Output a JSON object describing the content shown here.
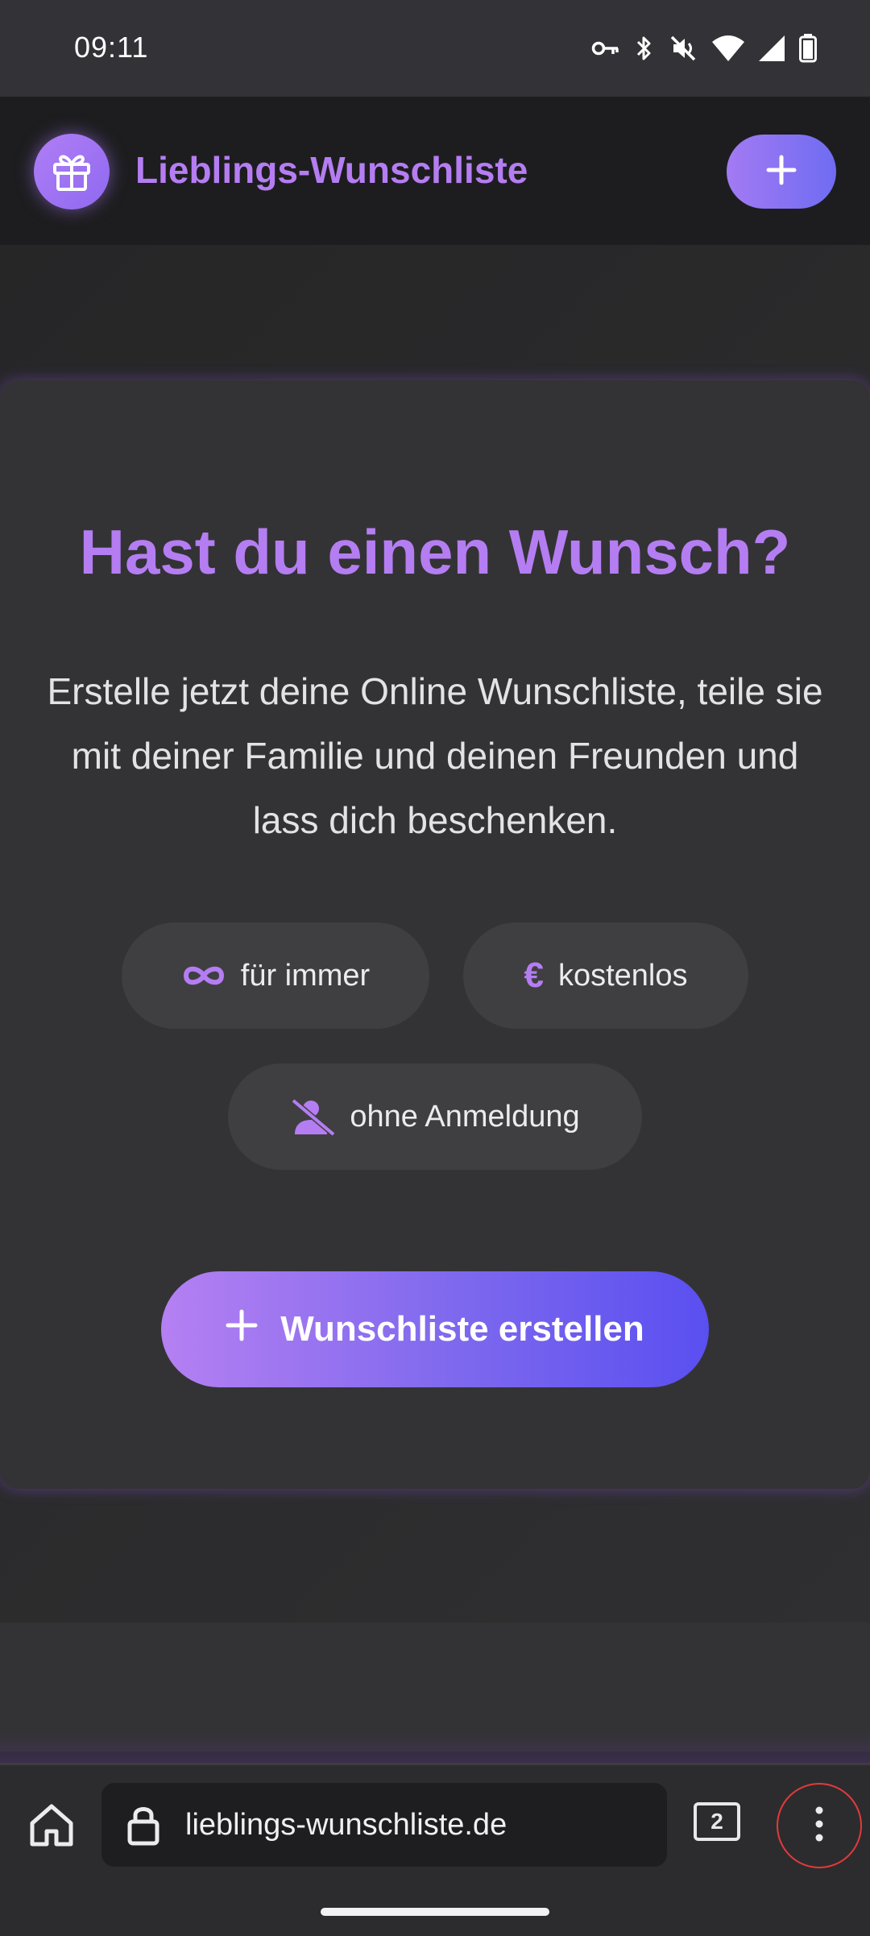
{
  "status_bar": {
    "time": "09:11",
    "icons": [
      "vpn-key-icon",
      "bluetooth-icon",
      "mute-icon",
      "wifi-icon",
      "signal-icon",
      "battery-icon"
    ]
  },
  "header": {
    "app_title": "Lieblings-Wunschliste",
    "logo_icon": "gift-icon",
    "add_button_icon": "plus-icon"
  },
  "hero": {
    "title": "Hast du einen Wunsch?",
    "description": "Erstelle jetzt deine Online Wunschliste, teile sie mit deiner Familie und deinen Freunden und lass dich beschenken.",
    "features": [
      {
        "icon": "infinity-icon",
        "label": "für immer"
      },
      {
        "icon": "euro-icon",
        "label": "kostenlos"
      },
      {
        "icon": "no-user-icon",
        "label": "ohne Anmeldung"
      }
    ],
    "cta_label": "Wunschliste erstellen",
    "cta_icon": "plus-icon"
  },
  "browser": {
    "url": "lieblings-wunschliste.de",
    "tab_count": "2",
    "home_icon": "home-icon",
    "lock_icon": "lock-icon",
    "menu_icon": "more-vert-icon"
  },
  "colors": {
    "accent": "#b57df2",
    "accent_gradient_start": "#b580f2",
    "accent_gradient_end": "#5a4ff0",
    "card_bg": "#333335",
    "header_bg": "#1d1d1f"
  }
}
